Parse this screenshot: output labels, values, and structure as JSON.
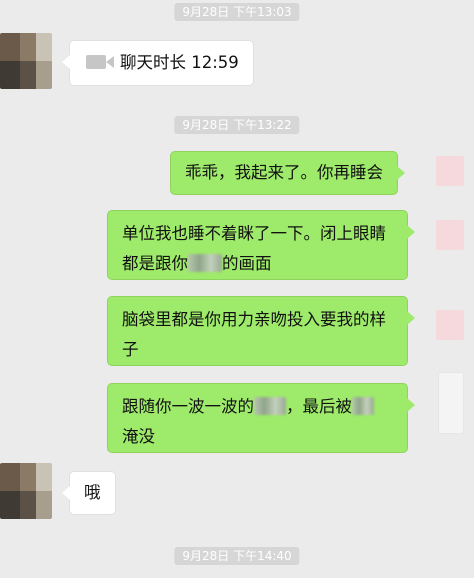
{
  "colors": {
    "chat_background": "#ebebeb",
    "outgoing_bubble": "#9eea6a",
    "incoming_bubble": "#ffffff",
    "timestamp_pill": "#d6d6d6"
  },
  "timestamps": [
    "9月28日 下午13:03",
    "9月28日 下午13:22",
    "9月28日 下午14:40"
  ],
  "messages": {
    "call": {
      "icon": "video-call-icon",
      "label": "聊天时长 12:59"
    },
    "m1": {
      "text": "乖乖，我起来了。你再睡会"
    },
    "m2": {
      "line1": "单位我也睡不着眯了一下。闭上眼睛",
      "line2_a": "都是跟你",
      "line2_b": "的画面"
    },
    "m3": {
      "line1": "脑袋里都是你用力亲吻投入要我的样",
      "line2": "子"
    },
    "m4": {
      "line1_a": "跟随你一波一波的",
      "line1_b": "，最后被",
      "line2": "淹没"
    },
    "m5": {
      "text": "哦"
    }
  }
}
